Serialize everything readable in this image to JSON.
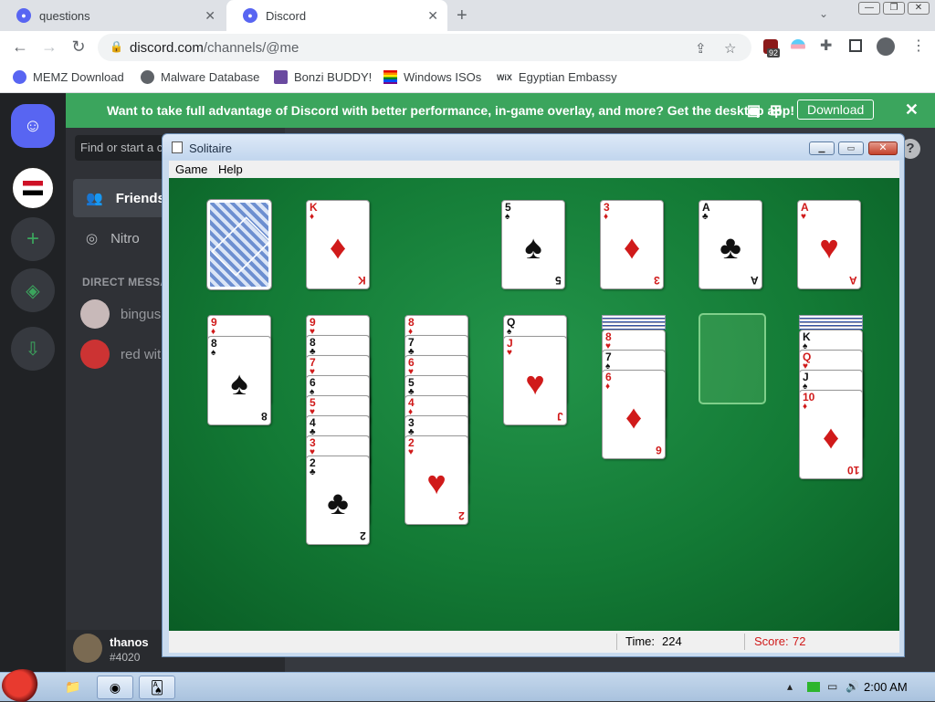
{
  "browser": {
    "tabs": [
      {
        "title": "questions"
      },
      {
        "title": "Discord"
      }
    ],
    "url_host": "discord.com",
    "url_path": "/channels/@me",
    "extension_badge": "92",
    "bookmarks": [
      {
        "label": "MEMZ Download"
      },
      {
        "label": "Malware Database"
      },
      {
        "label": "Bonzi BUDDY!"
      },
      {
        "label": "Windows ISOs"
      },
      {
        "label": "Egyptian Embassy"
      }
    ],
    "wix_label": "WiX"
  },
  "discord": {
    "banner_text": "Want to take full advantage of Discord with better performance, in-game overlay, and more? Get the desktop app!",
    "banner_button": "Download",
    "search_placeholder": "Find or start a c",
    "nav": [
      {
        "label": "Friends"
      },
      {
        "label": "Nitro"
      }
    ],
    "dm_header": "DIRECT MESSA",
    "dms": [
      {
        "name": "bingus"
      },
      {
        "name": "red wit"
      }
    ],
    "user": {
      "name": "thanos",
      "tag": "#4020"
    },
    "help": "?"
  },
  "solitaire": {
    "title": "Solitaire",
    "menu": [
      "Game",
      "Help"
    ],
    "time_label": "Time:",
    "time_value": "224",
    "score_label": "Score:",
    "score_value": "72",
    "stock": "card back",
    "waste": {
      "rank": "K",
      "suit": "♦"
    },
    "foundations": [
      {
        "rank": "5",
        "suit": "♠"
      },
      {
        "rank": "3",
        "suit": "♦"
      },
      {
        "rank": "A",
        "suit": "♣"
      },
      {
        "rank": "A",
        "suit": "♥"
      }
    ],
    "tableau": [
      [
        {
          "rank": "9",
          "suit": "♦"
        },
        {
          "rank": "8",
          "suit": "♠"
        }
      ],
      [
        {
          "rank": "9",
          "suit": "♥"
        },
        {
          "rank": "8",
          "suit": "♣"
        },
        {
          "rank": "7",
          "suit": "♥"
        },
        {
          "rank": "6",
          "suit": "♠"
        },
        {
          "rank": "5",
          "suit": "♥"
        },
        {
          "rank": "4",
          "suit": "♣"
        },
        {
          "rank": "3",
          "suit": "♥"
        },
        {
          "rank": "2",
          "suit": "♣"
        }
      ],
      [
        {
          "rank": "8",
          "suit": "♦"
        },
        {
          "rank": "7",
          "suit": "♣"
        },
        {
          "rank": "6",
          "suit": "♥"
        },
        {
          "rank": "5",
          "suit": "♣"
        },
        {
          "rank": "4",
          "suit": "♦"
        },
        {
          "rank": "3",
          "suit": "♣"
        },
        {
          "rank": "2",
          "suit": "♥"
        }
      ],
      [
        {
          "rank": "Q",
          "suit": "♠"
        },
        {
          "rank": "J",
          "suit": "♥"
        }
      ],
      [
        {
          "rank": "8",
          "suit": "♥"
        },
        {
          "rank": "7",
          "suit": "♠"
        },
        {
          "rank": "6",
          "suit": "♦"
        }
      ],
      [],
      [
        {
          "rank": "K",
          "suit": "♠"
        },
        {
          "rank": "Q",
          "suit": "♥"
        },
        {
          "rank": "J",
          "suit": "♠"
        },
        {
          "rank": "10",
          "suit": "♦"
        }
      ]
    ]
  },
  "taskbar": {
    "clock": "2:00 AM"
  },
  "colors": {
    "discord_blurple": "#5865f2",
    "banner_green": "#3ba55d",
    "felt_green": "#137a35",
    "card_red": "#d01a1a"
  }
}
